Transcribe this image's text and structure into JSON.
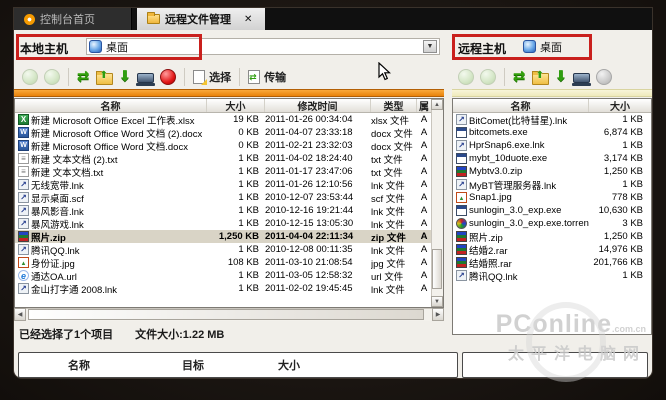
{
  "tabs": [
    {
      "label": "控制台首页",
      "icon": "console-icon"
    },
    {
      "label": "远程文件管理",
      "icon": "folder-icon",
      "close_glyph": "✕"
    }
  ],
  "left_panel": {
    "host_label": "本地主机",
    "location": {
      "icon": "desktop-icon",
      "value": "桌面",
      "dropdown_glyph": "▼"
    },
    "toolbar": {
      "select_label": "选择",
      "transfer_label": "传输"
    },
    "columns": {
      "name": "名称",
      "size": "大小",
      "mtime": "修改时间",
      "type": "类型",
      "attr": "属"
    },
    "files": [
      {
        "icon": "excel-icon",
        "name": "新建 Microsoft Office Excel 工作表.xlsx",
        "size": "19 KB",
        "mtime": "2011-01-26 00:34:04",
        "type": "xlsx 文件",
        "attr": "A",
        "selected": false
      },
      {
        "icon": "word-icon",
        "name": "新建 Microsoft Office Word 文档 (2).docx",
        "size": "0 KB",
        "mtime": "2011-04-07 23:33:18",
        "type": "docx 文件",
        "attr": "A",
        "selected": false
      },
      {
        "icon": "word-icon",
        "name": "新建 Microsoft Office Word 文档.docx",
        "size": "0 KB",
        "mtime": "2011-02-21 23:32:03",
        "type": "docx 文件",
        "attr": "A",
        "selected": false
      },
      {
        "icon": "text-icon",
        "name": "新建 文本文档 (2).txt",
        "size": "1 KB",
        "mtime": "2011-04-02 18:24:40",
        "type": "txt 文件",
        "attr": "A",
        "selected": false
      },
      {
        "icon": "text-icon",
        "name": "新建 文本文档.txt",
        "size": "1 KB",
        "mtime": "2011-01-17 23:47:06",
        "type": "txt 文件",
        "attr": "A",
        "selected": false
      },
      {
        "icon": "shortcut-icon",
        "name": "无线宽带.lnk",
        "size": "1 KB",
        "mtime": "2011-01-26 12:10:56",
        "type": "lnk 文件",
        "attr": "A",
        "selected": false
      },
      {
        "icon": "shortcut-icon",
        "name": "显示桌面.scf",
        "size": "1 KB",
        "mtime": "2010-12-07 23:53:44",
        "type": "scf 文件",
        "attr": "A",
        "selected": false
      },
      {
        "icon": "shortcut-icon",
        "name": "暴风影音.lnk",
        "size": "1 KB",
        "mtime": "2010-12-16 19:21:44",
        "type": "lnk 文件",
        "attr": "A",
        "selected": false
      },
      {
        "icon": "shortcut-icon",
        "name": "暴风游戏.lnk",
        "size": "1 KB",
        "mtime": "2010-12-15 13:05:30",
        "type": "lnk 文件",
        "attr": "A",
        "selected": false
      },
      {
        "icon": "zip-icon",
        "name": "照片.zip",
        "size": "1,250 KB",
        "mtime": "2011-04-04 22:11:34",
        "type": "zip 文件",
        "attr": "A",
        "selected": true
      },
      {
        "icon": "shortcut-icon",
        "name": "腾讯QQ.lnk",
        "size": "1 KB",
        "mtime": "2010-12-08 00:11:35",
        "type": "lnk 文件",
        "attr": "A",
        "selected": false
      },
      {
        "icon": "image-icon",
        "name": "身份证.jpg",
        "size": "108 KB",
        "mtime": "2011-03-10 21:08:54",
        "type": "jpg 文件",
        "attr": "A",
        "selected": false
      },
      {
        "icon": "url-icon",
        "name": "通达OA.url",
        "size": "1 KB",
        "mtime": "2011-03-05 12:58:32",
        "type": "url 文件",
        "attr": "A",
        "selected": false
      },
      {
        "icon": "shortcut-icon",
        "name": "金山打字通 2008.lnk",
        "size": "1 KB",
        "mtime": "2011-02-02 19:45:45",
        "type": "lnk 文件",
        "attr": "A",
        "selected": false
      }
    ],
    "status": {
      "selection": "已经选择了1个项目",
      "filesize": "文件大小:1.22 MB"
    }
  },
  "right_panel": {
    "host_label": "远程主机",
    "location": {
      "icon": "desktop-icon",
      "value": "桌面"
    },
    "columns": {
      "name": "名称",
      "size": "大小"
    },
    "files": [
      {
        "icon": "shortcut-icon",
        "name": "BitComet(比特彗星).lnk",
        "size": "1 KB",
        "selected": false
      },
      {
        "icon": "exe-icon",
        "name": "bitcomets.exe",
        "size": "6,874 KB",
        "selected": false
      },
      {
        "icon": "shortcut-icon",
        "name": "HprSnap6.exe.lnk",
        "size": "1 KB",
        "selected": false
      },
      {
        "icon": "exe-icon",
        "name": "mybt_10duote.exe",
        "size": "3,174 KB",
        "selected": false
      },
      {
        "icon": "zip-icon",
        "name": "Mybtv3.0.zip",
        "size": "1,250 KB",
        "selected": false
      },
      {
        "icon": "shortcut-icon",
        "name": "MyBT管理服务器.lnk",
        "size": "1 KB",
        "selected": false
      },
      {
        "icon": "image-icon",
        "name": "Snap1.jpg",
        "size": "778 KB",
        "selected": false
      },
      {
        "icon": "exe-icon",
        "name": "sunlogin_3.0_exp.exe",
        "size": "10,630 KB",
        "selected": false
      },
      {
        "icon": "torrent-icon",
        "name": "sunlogin_3.0_exp.exe.torrent",
        "size": "3 KB",
        "selected": false
      },
      {
        "icon": "zip-icon",
        "name": "照片.zip",
        "size": "1,250 KB",
        "selected": false
      },
      {
        "icon": "rar-icon",
        "name": "结婚2.rar",
        "size": "14,976 KB",
        "selected": false
      },
      {
        "icon": "rar-icon",
        "name": "结婚照.rar",
        "size": "201,766 KB",
        "selected": false
      },
      {
        "icon": "shortcut-icon",
        "name": "腾讯QQ.lnk",
        "size": "1 KB",
        "selected": false
      }
    ]
  },
  "transfer_queue": {
    "columns": {
      "name": "名称",
      "target": "目标",
      "size": "大小"
    }
  },
  "watermark": {
    "brand": "PConline",
    "suffix": ".com.cn",
    "subtitle": "太平洋电脑网"
  },
  "colors": {
    "accent_orange": "#e8820b",
    "annotation_red": "#c9201d",
    "selected_row": "#d9d4c6",
    "pale_strip": "#efeabc",
    "tab_bar": "#101010"
  }
}
